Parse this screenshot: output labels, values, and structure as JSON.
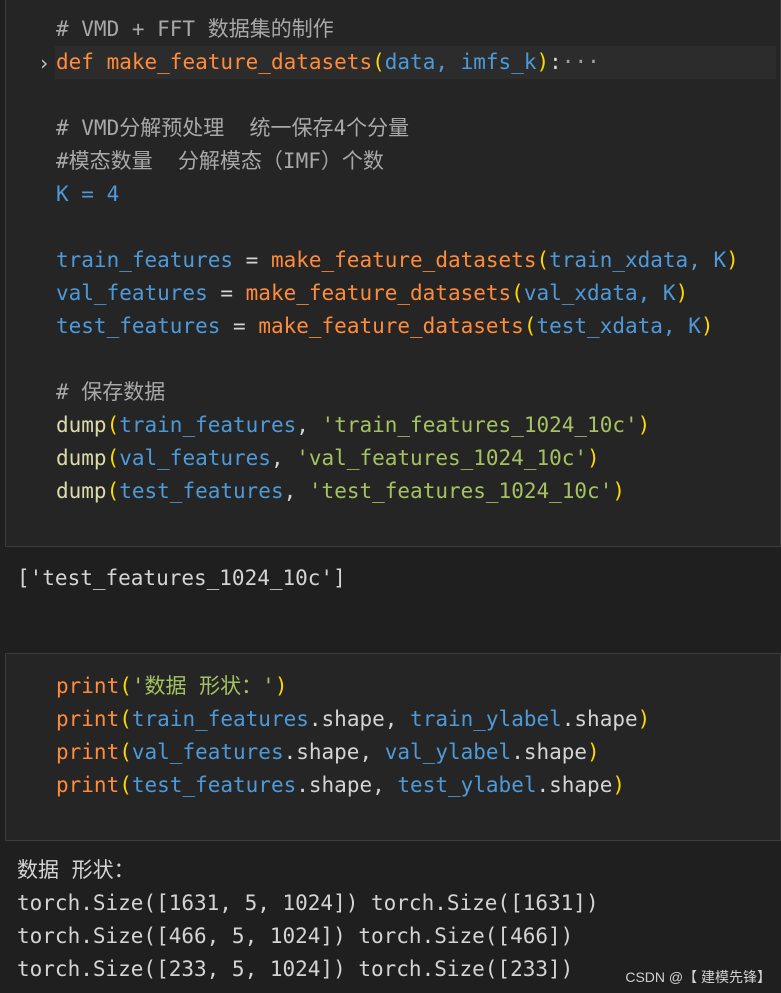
{
  "cell1": {
    "comment1": "# VMD + FFT 数据集的制作",
    "def_keyword": "def",
    "def_name": "make_feature_datasets",
    "def_open": "(",
    "def_params": "data, imfs_k",
    "def_close": ")",
    "def_colon": ":",
    "folded": "···",
    "comment2": "# VMD分解预处理  统一保存4个分量",
    "comment3": "#模态数量  分解模态（IMF）个数",
    "k_assign": "K = 4",
    "train_line": {
      "var": "train_features",
      "eq": " = ",
      "fn": "make_feature_datasets",
      "open": "(",
      "arg": "train_xdata, ",
      "k": "K",
      "close": ")"
    },
    "val_line": {
      "var": "val_features",
      "eq": " = ",
      "fn": "make_feature_datasets",
      "open": "(",
      "arg": "val_xdata, ",
      "k": "K",
      "close": ")"
    },
    "test_line": {
      "var": "test_features",
      "eq": " = ",
      "fn": "make_feature_datasets",
      "open": "(",
      "arg": "test_xdata, ",
      "k": "K",
      "close": ")"
    },
    "comment4": "# 保存数据",
    "dump1": {
      "fn": "dump",
      "open": "(",
      "arg": "train_features",
      "sep": ", ",
      "str": "'train_features_1024_10c'",
      "close": ")"
    },
    "dump2": {
      "fn": "dump",
      "open": "(",
      "arg": "val_features",
      "sep": ", ",
      "str": "'val_features_1024_10c'",
      "close": ")"
    },
    "dump3": {
      "fn": "dump",
      "open": "(",
      "arg": "test_features",
      "sep": ", ",
      "str": "'test_features_1024_10c'",
      "close": ")"
    }
  },
  "output1": "['test_features_1024_10c']",
  "cell2": {
    "print1": {
      "fn": "print",
      "open": "(",
      "str": "'数据 形状：'",
      "close": ")"
    },
    "print2": {
      "fn": "print",
      "open": "(",
      "a": "train_features",
      "a_attr": ".shape",
      "sep": ", ",
      "b": "train_ylabel",
      "b_attr": ".shape",
      "close": ")"
    },
    "print3": {
      "fn": "print",
      "open": "(",
      "a": "val_features",
      "a_attr": ".shape",
      "sep": ", ",
      "b": "val_ylabel",
      "b_attr": ".shape",
      "close": ")"
    },
    "print4": {
      "fn": "print",
      "open": "(",
      "a": "test_features",
      "a_attr": ".shape",
      "sep": ", ",
      "b": "test_ylabel",
      "b_attr": ".shape",
      "close": ")"
    }
  },
  "output2": [
    "数据 形状：",
    "torch.Size([1631, 5, 1024]) torch.Size([1631])",
    "torch.Size([466, 5, 1024]) torch.Size([466])",
    "torch.Size([233, 5, 1024]) torch.Size([233])"
  ],
  "watermark": "CSDN @【 建模先锋】"
}
